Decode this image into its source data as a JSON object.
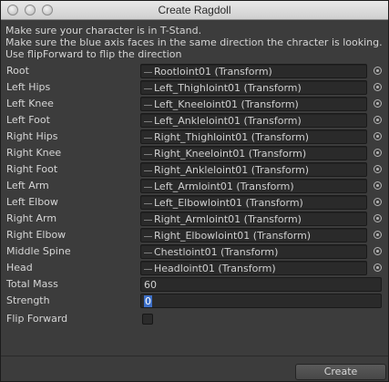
{
  "window": {
    "title": "Create Ragdoll"
  },
  "help": {
    "lines": [
      "Make sure your character is in T-Stand.",
      "Make sure the blue axis faces in the same direction the chracter is looking.",
      "Use flipForward to flip the direction"
    ]
  },
  "bones": [
    {
      "label": "Root",
      "value": "Rootloint01 (Transform)"
    },
    {
      "label": "Left Hips",
      "value": "Left_Thighloint01 (Transform)"
    },
    {
      "label": "Left Knee",
      "value": "Left_Kneeloint01 (Transform)"
    },
    {
      "label": "Left Foot",
      "value": "Left_Ankleloint01 (Transform)"
    },
    {
      "label": "Right Hips",
      "value": "Right_Thighloint01 (Transform)"
    },
    {
      "label": "Right Knee",
      "value": "Right_Kneeloint01 (Transform)"
    },
    {
      "label": "Right Foot",
      "value": "Right_Ankleloint01 (Transform)"
    },
    {
      "label": "Left Arm",
      "value": "Left_Armloint01 (Transform)"
    },
    {
      "label": "Left Elbow",
      "value": "Left_Elbowloint01 (Transform)"
    },
    {
      "label": "Right Arm",
      "value": "Right_Armloint01 (Transform)"
    },
    {
      "label": "Right Elbow",
      "value": "Right_Elbowloint01 (Transform)"
    },
    {
      "label": "Middle Spine",
      "value": "Chestloint01 (Transform)"
    },
    {
      "label": "Head",
      "value": "Headloint01 (Transform)"
    }
  ],
  "total_mass": {
    "label": "Total Mass",
    "value": "60"
  },
  "strength": {
    "label": "Strength",
    "value": "0"
  },
  "flip_forward": {
    "label": "Flip Forward",
    "checked": false
  },
  "create_button": {
    "label": "Create"
  }
}
